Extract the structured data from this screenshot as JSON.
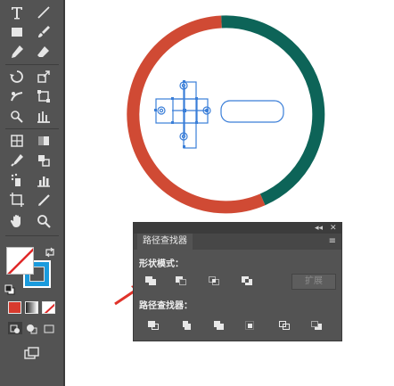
{
  "toolbar": {
    "icons": [
      "type-icon",
      "line-segment-icon",
      "rectangle-icon",
      "paintbrush-icon",
      "pencil-icon",
      "eraser-icon",
      "rotate-icon",
      "scale-icon",
      "warp-icon",
      "free-transform-icon",
      "shape-builder-icon",
      "perspective-icon",
      "mesh-icon",
      "gradient-icon",
      "eyedropper-icon",
      "blend-icon",
      "symbol-sprayer-icon",
      "column-graph-icon",
      "artboard-icon",
      "slice-icon",
      "hand-icon",
      "zoom-icon"
    ]
  },
  "colors": {
    "ring_red": "#d04a34",
    "ring_teal": "#0d6458",
    "selection_blue": "#3a7ed8",
    "panel_bg": "#535353",
    "arrow_red": "#e0332a"
  },
  "pathfinder": {
    "tab_label": "路径查找器",
    "shape_modes_label": "形状模式：",
    "pathfinders_label": "路径查找器：",
    "expand_label": "扩展",
    "collapse_glyph": "◂◂",
    "close_glyph": "✕",
    "menu_glyph": "≡"
  }
}
